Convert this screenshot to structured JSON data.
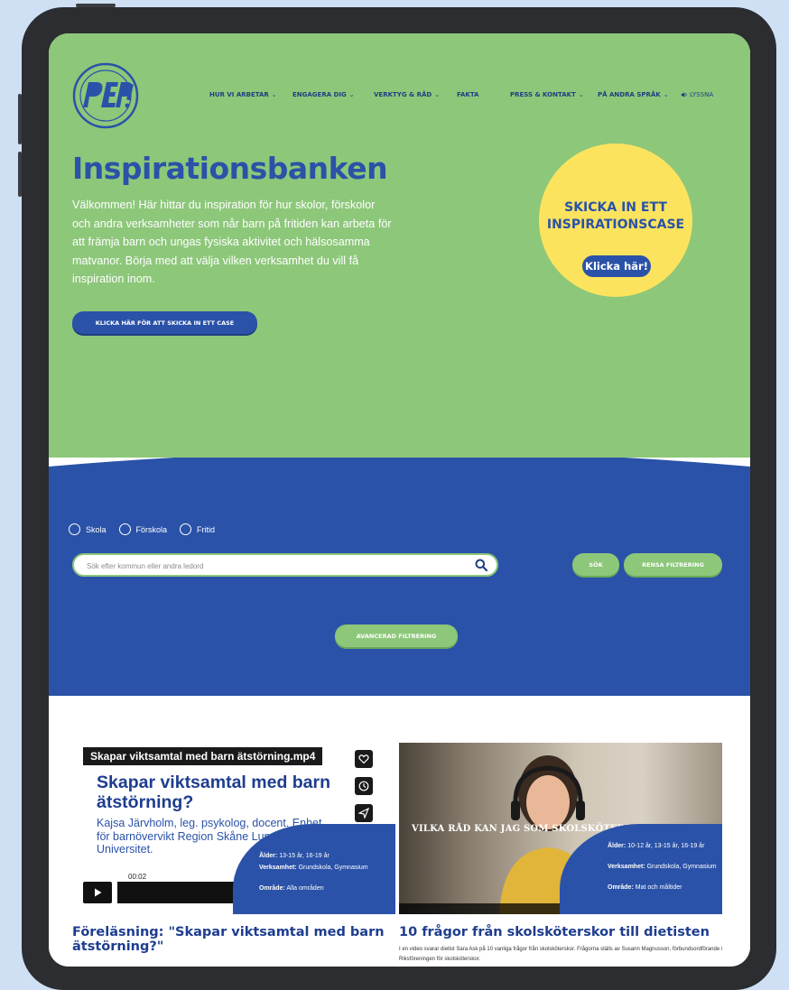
{
  "nav": {
    "items": [
      {
        "label": "HUR VI ARBETAR",
        "chevron": true
      },
      {
        "label": "ENGAGERA DIG",
        "chevron": true
      },
      {
        "label": "VERKTYG & RÅD",
        "chevron": true
      },
      {
        "label": "FAKTA",
        "chevron": false
      },
      {
        "label": "PRESS & KONTAKT",
        "chevron": true
      },
      {
        "label": "PÅ ANDRA SPRÅK",
        "chevron": true
      }
    ],
    "listen_label": "LYSSNA"
  },
  "hero": {
    "title": "Inspirationsbanken",
    "intro": "Välkommen! Här hittar du inspiration för hur skolor, förskolor och andra verksamheter som når barn på fritiden kan arbeta för att främja barn och ungas fysiska aktivitet och hälsosamma matvanor. Börja med att välja vilken verksamhet du vill få inspiration inom.",
    "case_button": "KLICKA HÄR FÖR ATT SKICKA IN ETT CASE"
  },
  "callout": {
    "heading": "SKICKA IN ETT INSPIRATIONSCASE",
    "button": "Klicka här!"
  },
  "filters": {
    "radios": [
      "Skola",
      "Förskola",
      "Fritid"
    ],
    "search_placeholder": "Sök efter kommun eller andra ledord",
    "search_button": "SÖK",
    "clear_button": "RENSA FILTRERING",
    "advanced_button": "AVANCERAD FILTRERING"
  },
  "cards": [
    {
      "video_title": "Skapar viktsamtal med barn ätstörning.mp4",
      "slide_heading": "Skapar viktsamtal med barn ätstörning?",
      "slide_sub": "Kajsa Järvholm, leg. psykolog, docent. Enhet för barnövervikt Region Skåne Lunds Universitet.",
      "time": "00:02",
      "age_label": "Ålder:",
      "age": "13-15 år, 16-19 år",
      "org_label": "Verksamhet:",
      "org": "Grundskola, Gymnasium",
      "area_label": "Område:",
      "area": "Alla områden",
      "title": "Föreläsning: \"Skapar viktsamtal med barn ätstörning?\""
    },
    {
      "video_caption": "VILKA RÅD KAN JAG SOM SKOLSKÖTERSKA",
      "age_label": "Ålder:",
      "age": "10-12 år, 13-15 år, 16-19 år",
      "org_label": "Verksamhet:",
      "org": "Grundskola, Gymnasium",
      "area_label": "Område:",
      "area": "Mat och måltider",
      "title": "10 frågor från skolsköterskor till dietisten",
      "desc": "I en video svarar dietist Sara Ask på 10 vanliga frågor från skolsköterskor. Frågorna ställs av Susann Magnusson, förbundsordförande i Riksföreningen för skolsköterskor."
    }
  ],
  "colors": {
    "green": "#8dc77a",
    "blue": "#2a52a8",
    "yellow": "#fce35e",
    "device_frame": "#2b2d31",
    "backdrop": "#cfe0f5"
  }
}
